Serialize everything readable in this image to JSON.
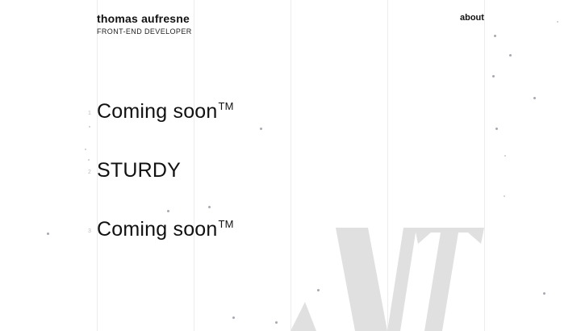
{
  "header": {
    "name": "thomas aufresne",
    "role": "FRONT-END DEVELOPER",
    "nav_about": "about"
  },
  "projects": [
    {
      "title": "Coming soon",
      "mark": "TM",
      "index": "1"
    },
    {
      "title": "STURDY",
      "mark": "",
      "index": "2"
    },
    {
      "title": "Coming soon",
      "mark": "TM",
      "index": "3"
    }
  ],
  "background": {
    "watermark_color": "#e0e0e0",
    "grid_color": "#ececec",
    "particle_color": "#a8a8b0"
  }
}
